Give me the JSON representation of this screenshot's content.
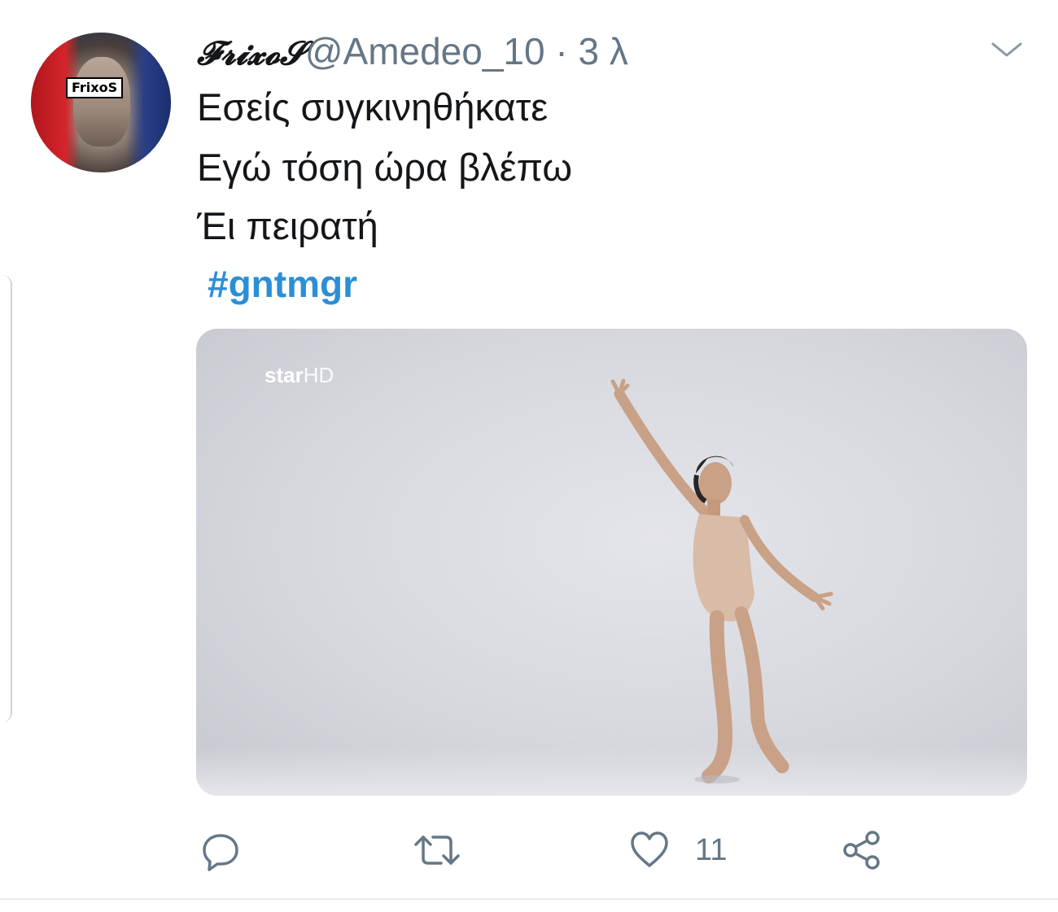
{
  "tweet": {
    "avatar_label": "FrixoS",
    "display_name": "𝓕𝓻𝓲𝔁𝓸𝓢",
    "handle_time": "@Amedeo_10 · 3 λ",
    "lines": [
      "Εσείς συγκινηθήκατε",
      "Εγώ τόση ώρα βλέπω",
      "Έι πειρατή"
    ],
    "hashtag": "#gntmgr",
    "media": {
      "logo_main": "star",
      "logo_suffix": "HD"
    },
    "actions": {
      "like_count": "11"
    }
  },
  "colors": {
    "text": "#14171a",
    "secondary": "#657786",
    "hashtag": "#2b8fd6",
    "divider": "#e6ecf0"
  },
  "icons": [
    "chevron-down-icon",
    "reply-icon",
    "retweet-icon",
    "heart-icon",
    "share-icon"
  ]
}
